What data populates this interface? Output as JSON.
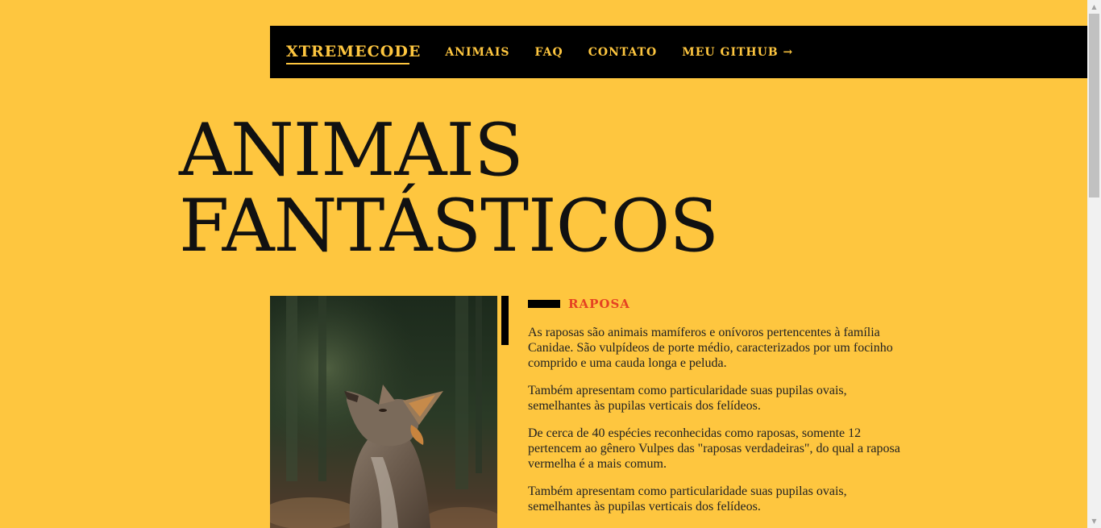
{
  "nav": {
    "brand": "XTREMECODE",
    "links": [
      "ANIMAIS",
      "FAQ",
      "CONTATO",
      "MEU GITHUB →"
    ]
  },
  "hero": {
    "line1": "ANIMAIS",
    "line2": "FANTÁSTICOS"
  },
  "animal": {
    "image_icon": "fox-photo",
    "title": "RAPOSA",
    "paragraphs": [
      "As raposas são animais mamíferos e onívoros pertencentes à família Canidae. São vulpídeos de porte médio, caracterizados por um focinho comprido e uma cauda longa e peluda.",
      "Também apresentam como particularidade suas pupilas ovais, semelhantes às pupilas verticais dos felídeos.",
      "De cerca de 40 espécies reconhecidas como raposas, somente 12 pertencem ao gênero Vulpes das \"raposas verdadeiras\", do qual a raposa vermelha é a mais comum.",
      "Também apresentam como particularidade suas pupilas ovais, semelhantes às pupilas verticais dos felídeos."
    ]
  },
  "scrollbar": {
    "up_icon": "▲",
    "down_icon": "▼"
  },
  "colors": {
    "background": "#FEC63F",
    "nav_bg": "#000000",
    "accent": "#E54222"
  }
}
